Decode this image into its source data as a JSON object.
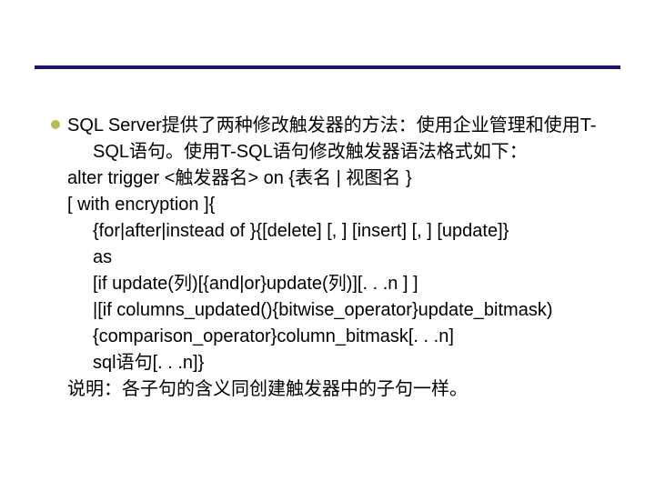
{
  "content": {
    "p1": "SQL Server提供了两种修改触发器的方法：使用企业管理和使用T-",
    "p1b": "SQL语句。使用T-SQL语句修改触发器语法格式如下：",
    "p2": "alter trigger <触发器名> on {表名 | 视图名 }",
    "p3": "[ with encryption ]{",
    "p4": "{for|after|instead of }{[delete] [, ] [insert] [, ] [update]}",
    "p5": "as",
    "p6": "[if update(列)[{and|or}update(列)][. . .n ] ]",
    "p7": "|[if columns_updated(){bitwise_operator}update_bitmask)",
    "p8": "{comparison_operator}column_bitmask[. . .n]",
    "p9": "sql语句[. . .n]}",
    "p10": "说明：各子句的含义同创建触发器中的子句一样。"
  }
}
